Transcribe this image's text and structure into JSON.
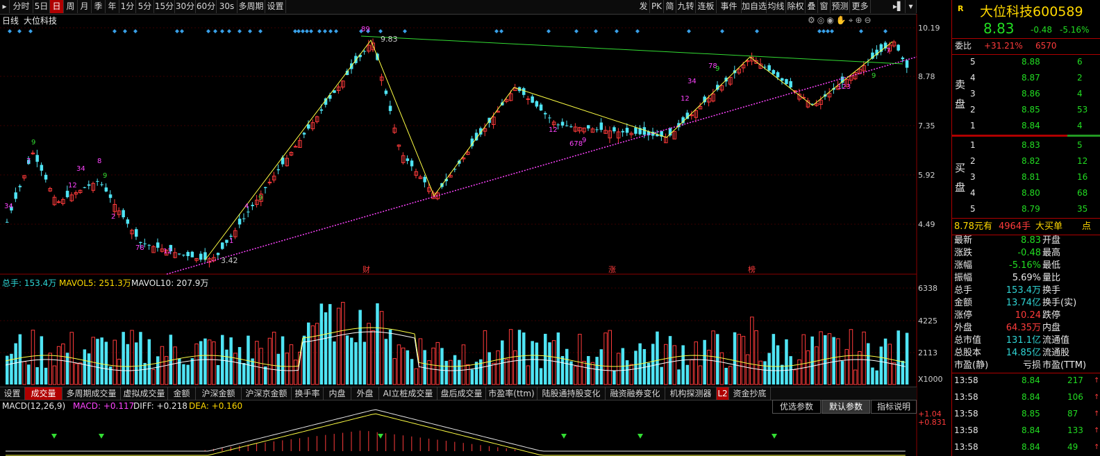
{
  "toolbar": {
    "left_tabs": [
      "分时",
      "5日",
      "日",
      "周",
      "月",
      "季",
      "年",
      "1分",
      "5分",
      "15分",
      "30分",
      "60分",
      "30s",
      "多周期",
      "设置"
    ],
    "active_tab": "日",
    "right_tabs": [
      "发",
      "PK",
      "简",
      "九转",
      "连板",
      "事件",
      "加自选",
      "均线",
      "除权",
      "叠",
      "窗",
      "预测",
      "更多"
    ]
  },
  "chart": {
    "period_label": "日线",
    "stock_name": "大位科技",
    "price_axis": [
      "10.19",
      "8.78",
      "7.35",
      "5.92",
      "4.49"
    ],
    "high_label": "9.83",
    "low_label": "3.42",
    "event_markers": [
      "财",
      "涨",
      "榜"
    ],
    "colors": {
      "up": "#ff3b3b",
      "down": "#4fe4f4",
      "ma5": "#ffff44",
      "ma10": "#ffffff",
      "trend_green": "#33dd33",
      "trend_mag": "#ff44ff"
    }
  },
  "volume": {
    "summary_label": "总手: 153.4万",
    "mavol5_label": "MAVOL5: 251.3万",
    "mavol10_label": "MAVOL10: 207.9万",
    "axis": [
      "6338",
      "4225",
      "2113"
    ],
    "unit": "X1000",
    "tabs": [
      "设置",
      "成交量",
      "多周期成交量",
      "虚拟成交量",
      "金额",
      "沪深金额",
      "沪深京金额",
      "换手率",
      "内盘",
      "外盘",
      "AI立桩成交量",
      "盘后成交量",
      "市盈率(ttm)",
      "陆股通持股变化",
      "融资融券变化",
      "机构探测器",
      "L2",
      "资金抄底"
    ],
    "active_tab": "成交量"
  },
  "macd": {
    "title": "MACD(12,26,9)",
    "macd_label": "MACD: +0.117",
    "diff_label": "DIFF: +0.218",
    "dea_label": "DEA: +0.160",
    "buttons": [
      "优选参数",
      "默认参数",
      "指标说明"
    ],
    "axis": [
      "+1.04",
      "+0.831"
    ]
  },
  "quote": {
    "r_badge": "R",
    "name": "大位科技",
    "code": "600589",
    "price": "8.83",
    "change": "-0.48",
    "change_pct": "-5.16%",
    "weibi_label": "委比",
    "weibi_value": "+31.21%",
    "weibi_diff": "6570",
    "sell_label": [
      "卖",
      "盘"
    ],
    "buy_label": [
      "买",
      "盘"
    ],
    "asks": [
      {
        "level": "5",
        "price": "8.88",
        "vol": "6"
      },
      {
        "level": "4",
        "price": "8.87",
        "vol": "2"
      },
      {
        "level": "3",
        "price": "8.86",
        "vol": "4"
      },
      {
        "level": "2",
        "price": "8.85",
        "vol": "53"
      },
      {
        "level": "1",
        "price": "8.84",
        "vol": "4"
      }
    ],
    "bids": [
      {
        "level": "1",
        "price": "8.83",
        "vol": "5"
      },
      {
        "level": "2",
        "price": "8.82",
        "vol": "12"
      },
      {
        "level": "3",
        "price": "8.81",
        "vol": "16"
      },
      {
        "level": "4",
        "price": "8.80",
        "vol": "68"
      },
      {
        "level": "5",
        "price": "8.79",
        "vol": "35"
      }
    ],
    "big_order": {
      "price": "8.78元有",
      "vol": "4964手",
      "label": "大买单",
      "more": "点"
    },
    "stats": [
      {
        "k": "最新",
        "v": "8.83",
        "k2": "开盘",
        "c": "grn"
      },
      {
        "k": "涨跌",
        "v": "-0.48",
        "k2": "最高",
        "c": "grn"
      },
      {
        "k": "涨幅",
        "v": "-5.16%",
        "k2": "最低",
        "c": "grn"
      },
      {
        "k": "振幅",
        "v": "5.69%",
        "k2": "量比",
        "c": "wht"
      },
      {
        "k": "总手",
        "v": "153.4万",
        "k2": "换手",
        "c": "cyn"
      },
      {
        "k": "金额",
        "v": "13.74亿",
        "k2": "换手(实)",
        "c": "cyn"
      },
      {
        "k": "涨停",
        "v": "10.24",
        "k2": "跌停",
        "c": "red"
      },
      {
        "k": "外盘",
        "v": "64.35万",
        "k2": "内盘",
        "c": "red"
      },
      {
        "k": "总市值",
        "v": "131.1亿",
        "k2": "流通值",
        "c": "cyn"
      },
      {
        "k": "总股本",
        "v": "14.85亿",
        "k2": "流通股",
        "c": "cyn"
      },
      {
        "k": "市盈(静)",
        "v": "亏损",
        "k2": "市盈(TTM)",
        "c": "wht"
      }
    ],
    "ticks": [
      {
        "time": "13:58",
        "price": "8.84",
        "vol": "217"
      },
      {
        "time": "13:58",
        "price": "8.84",
        "vol": "106"
      },
      {
        "time": "13:58",
        "price": "8.85",
        "vol": "87"
      },
      {
        "time": "13:58",
        "price": "8.84",
        "vol": "133"
      },
      {
        "time": "13:58",
        "price": "8.84",
        "vol": "49"
      }
    ]
  }
}
